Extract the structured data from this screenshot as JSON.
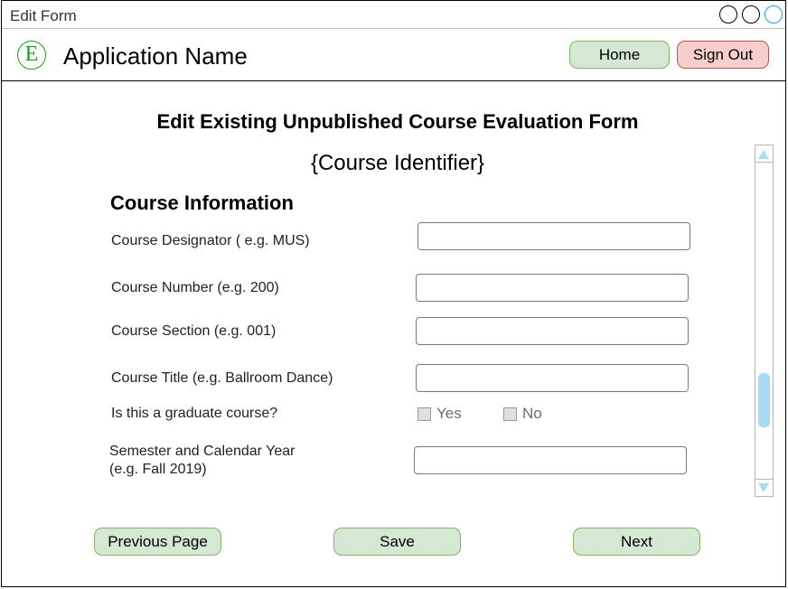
{
  "window": {
    "title": "Edit Form"
  },
  "header": {
    "logo_letter": "E",
    "app_name": "Application Name",
    "home_label": "Home",
    "signout_label": "Sign Out"
  },
  "page": {
    "title": "Edit Existing Unpublished Course Evaluation Form",
    "subtitle": "{Course Identifier}"
  },
  "form": {
    "section_title": "Course Information",
    "fields": [
      {
        "label": "Course Designator ( e.g. MUS)",
        "value": ""
      },
      {
        "label": "Course Number (e.g. 200)",
        "value": ""
      },
      {
        "label": "Course Section (e.g. 001)",
        "value": ""
      },
      {
        "label": "Course Title (e.g. Ballroom Dance)",
        "value": ""
      },
      {
        "label_line1": "Semester and Calendar Year",
        "label_line2": "(e.g. Fall 2019)",
        "value": ""
      }
    ],
    "graduate_question": "Is this a graduate course?",
    "yes_label": "Yes",
    "no_label": "No"
  },
  "footer": {
    "prev_label": "Previous Page",
    "save_label": "Save",
    "next_label": "Next"
  },
  "colors": {
    "green_fill": "#d5e8d4",
    "green_border": "#82b366",
    "red_fill": "#f8cecc",
    "red_border": "#b85450",
    "scroll_accent": "#a8dcf5"
  }
}
